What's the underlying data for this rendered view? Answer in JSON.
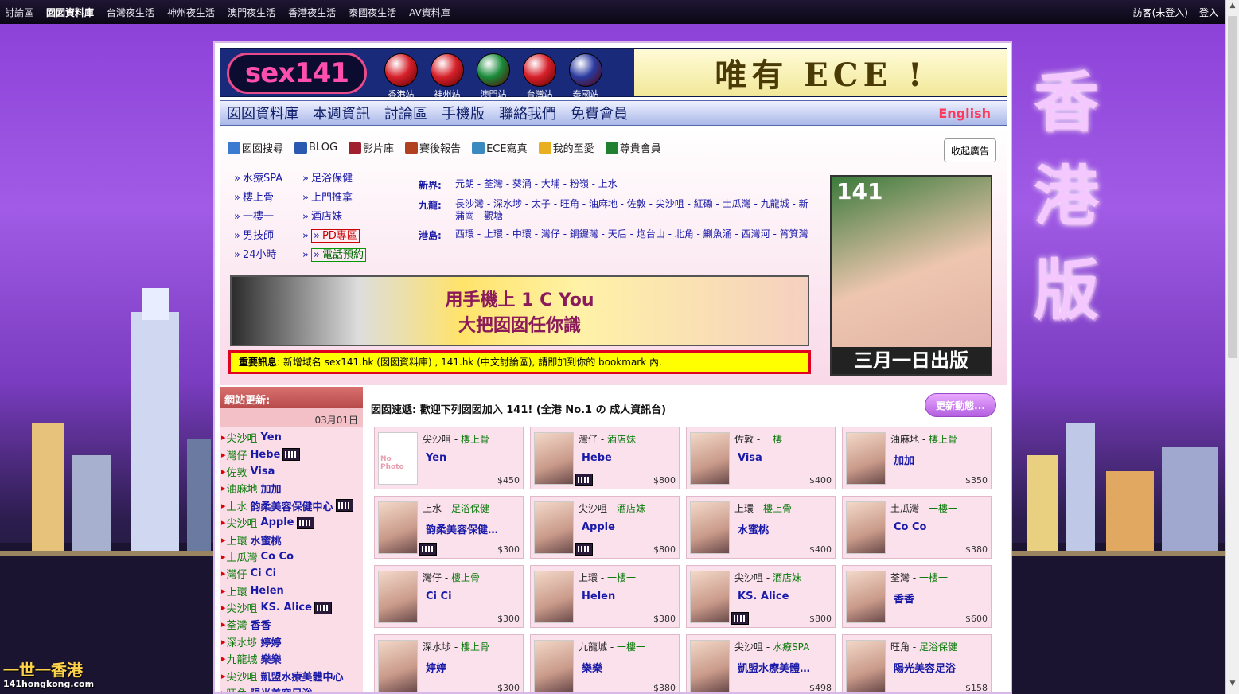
{
  "topbar": {
    "nav": [
      "討論區",
      "囡囡資料庫",
      "台灣夜生活",
      "神州夜生活",
      "澳門夜生活",
      "香港夜生活",
      "泰國夜生活",
      "AV資料庫"
    ],
    "active_index": 1,
    "guest": "訪客(未登入)",
    "login": "登入"
  },
  "side_title": [
    "香",
    "港",
    "版"
  ],
  "brand_logo": "一世一香港",
  "brand_url": "141hongkong.com",
  "header": {
    "logo": "sex141",
    "stations": [
      {
        "label": "香港站",
        "color": "#d6202a"
      },
      {
        "label": "神州站",
        "color": "#d6202a"
      },
      {
        "label": "澳門站",
        "color": "#1a8a3a"
      },
      {
        "label": "台灣站",
        "color": "#d6202a"
      },
      {
        "label": "泰國站",
        "color": "#2a3aa0"
      }
    ],
    "banner": "唯有 ECE !"
  },
  "mainnav": {
    "items": [
      "囡囡資料庫",
      "本週資訊",
      "討論區",
      "手機版",
      "聯絡我們",
      "免費會員"
    ],
    "english": "English"
  },
  "toolbar": {
    "items": [
      {
        "label": "囡囡搜尋",
        "icon": "search-icon",
        "color": "#3a7ad0"
      },
      {
        "label": "BLOG",
        "icon": "blog-icon",
        "color": "#2a5ab0"
      },
      {
        "label": "影片庫",
        "icon": "video-icon",
        "color": "#a02030"
      },
      {
        "label": "賽後報告",
        "icon": "report-icon",
        "color": "#b04020"
      },
      {
        "label": "ECE寫真",
        "icon": "camera-icon",
        "color": "#3a8ac0"
      },
      {
        "label": "我的至愛",
        "icon": "star-icon",
        "color": "#e8b020"
      },
      {
        "label": "尊貴會員",
        "icon": "dollar-icon",
        "color": "#208030"
      }
    ],
    "close_ad": "收起廣告"
  },
  "categories": {
    "col1": [
      "水療SPA",
      "樓上骨",
      "一樓一",
      "男技師",
      "24小時"
    ],
    "col2": [
      "足浴保健",
      "上門推拿",
      "酒店妹",
      "PD專區",
      "電話預約"
    ]
  },
  "regions": [
    {
      "name": "新界:",
      "links": "元朗 - 荃灣 - 葵涌 - 大埔 - 粉嶺 - 上水"
    },
    {
      "name": "九龍:",
      "links": "長沙灣 - 深水埗 - 太子 - 旺角 - 油麻地 - 佐敦 - 尖沙咀 - 紅磡 - 土瓜灣 - 九龍城 - 新蒲崗 - 觀塘"
    },
    {
      "name": "港島:",
      "links": "西環 - 上環 - 中環 - 灣仔 - 銅鑼灣 - 天后 - 炮台山 - 北角 - 鰂魚涌 - 西灣河 - 筲箕灣"
    }
  ],
  "phone_ad": {
    "line1": "用手機上 1 C You",
    "line2": "大把囡囡任你識"
  },
  "notice": {
    "label": "重要訊息",
    "text": ": 新增域名 sex141.hk (囡囡資料庫) , 141.hk (中文討論區), 請即加到你的 bookmark 內."
  },
  "magazine": {
    "title": "141",
    "footer": "三月一日出版"
  },
  "sidebar": {
    "header": "網站更新:",
    "date": "03月01日",
    "items": [
      {
        "area": "尖沙咀",
        "name": "Yen",
        "video": false
      },
      {
        "area": "灣仔",
        "name": "Hebe",
        "video": true
      },
      {
        "area": "佐敦",
        "name": "Visa",
        "video": false
      },
      {
        "area": "油麻地",
        "name": "加加",
        "video": false
      },
      {
        "area": "上水",
        "name": "韵柔美容保健中心",
        "video": true
      },
      {
        "area": "尖沙咀",
        "name": "Apple",
        "video": true
      },
      {
        "area": "上環",
        "name": "水蜜桃",
        "video": false
      },
      {
        "area": "土瓜灣",
        "name": "Co Co",
        "video": false
      },
      {
        "area": "灣仔",
        "name": "Ci Ci",
        "video": false
      },
      {
        "area": "上環",
        "name": "Helen",
        "video": false
      },
      {
        "area": "尖沙咀",
        "name": "KS. Alice",
        "video": true
      },
      {
        "area": "荃灣",
        "name": "香香",
        "video": false
      },
      {
        "area": "深水埗",
        "name": "婷婷",
        "video": false
      },
      {
        "area": "九龍城",
        "name": "樂樂",
        "video": false
      },
      {
        "area": "尖沙咀",
        "name": "凱盟水療美體中心",
        "video": false
      },
      {
        "area": "旺角",
        "name": "陽光美容足浴",
        "video": false
      }
    ]
  },
  "main": {
    "welcome": "囡囡速遞: 歡迎下列囡囡加入 141! (全港 No.1 の 成人資訊台)",
    "update_button": "更新動態..."
  },
  "cards": [
    {
      "area": "尖沙咀",
      "cat": "樓上骨",
      "name": "Yen",
      "price": "$450",
      "video": false,
      "nophoto": true
    },
    {
      "area": "灣仔",
      "cat": "酒店妹",
      "name": "Hebe",
      "price": "$800",
      "video": true,
      "nophoto": false
    },
    {
      "area": "佐敦",
      "cat": "一樓一",
      "name": "Visa",
      "price": "$400",
      "video": false,
      "nophoto": false
    },
    {
      "area": "油麻地",
      "cat": "樓上骨",
      "name": "加加",
      "price": "$350",
      "video": false,
      "nophoto": false
    },
    {
      "area": "上水",
      "cat": "足浴保健",
      "name": "韵柔美容保健…",
      "price": "$300",
      "video": true,
      "nophoto": false
    },
    {
      "area": "尖沙咀",
      "cat": "酒店妹",
      "name": "Apple",
      "price": "$800",
      "video": true,
      "nophoto": false
    },
    {
      "area": "上環",
      "cat": "樓上骨",
      "name": "水蜜桃",
      "price": "$400",
      "video": false,
      "nophoto": false
    },
    {
      "area": "土瓜灣",
      "cat": "一樓一",
      "name": "Co Co",
      "price": "$380",
      "video": false,
      "nophoto": false
    },
    {
      "area": "灣仔",
      "cat": "樓上骨",
      "name": "Ci Ci",
      "price": "$300",
      "video": false,
      "nophoto": false
    },
    {
      "area": "上環",
      "cat": "一樓一",
      "name": "Helen",
      "price": "$380",
      "video": false,
      "nophoto": false
    },
    {
      "area": "尖沙咀",
      "cat": "酒店妹",
      "name": "KS. Alice",
      "price": "$800",
      "video": true,
      "nophoto": false
    },
    {
      "area": "荃灣",
      "cat": "一樓一",
      "name": "香香",
      "price": "$600",
      "video": false,
      "nophoto": false
    },
    {
      "area": "深水埗",
      "cat": "樓上骨",
      "name": "婷婷",
      "price": "$300",
      "video": false,
      "nophoto": false
    },
    {
      "area": "九龍城",
      "cat": "一樓一",
      "name": "樂樂",
      "price": "$380",
      "video": false,
      "nophoto": false
    },
    {
      "area": "尖沙咀",
      "cat": "水療SPA",
      "name": "凱盟水療美體…",
      "price": "$498",
      "video": false,
      "nophoto": false
    },
    {
      "area": "旺角",
      "cat": "足浴保健",
      "name": "陽光美容足浴",
      "price": "$158",
      "video": false,
      "nophoto": false
    }
  ]
}
